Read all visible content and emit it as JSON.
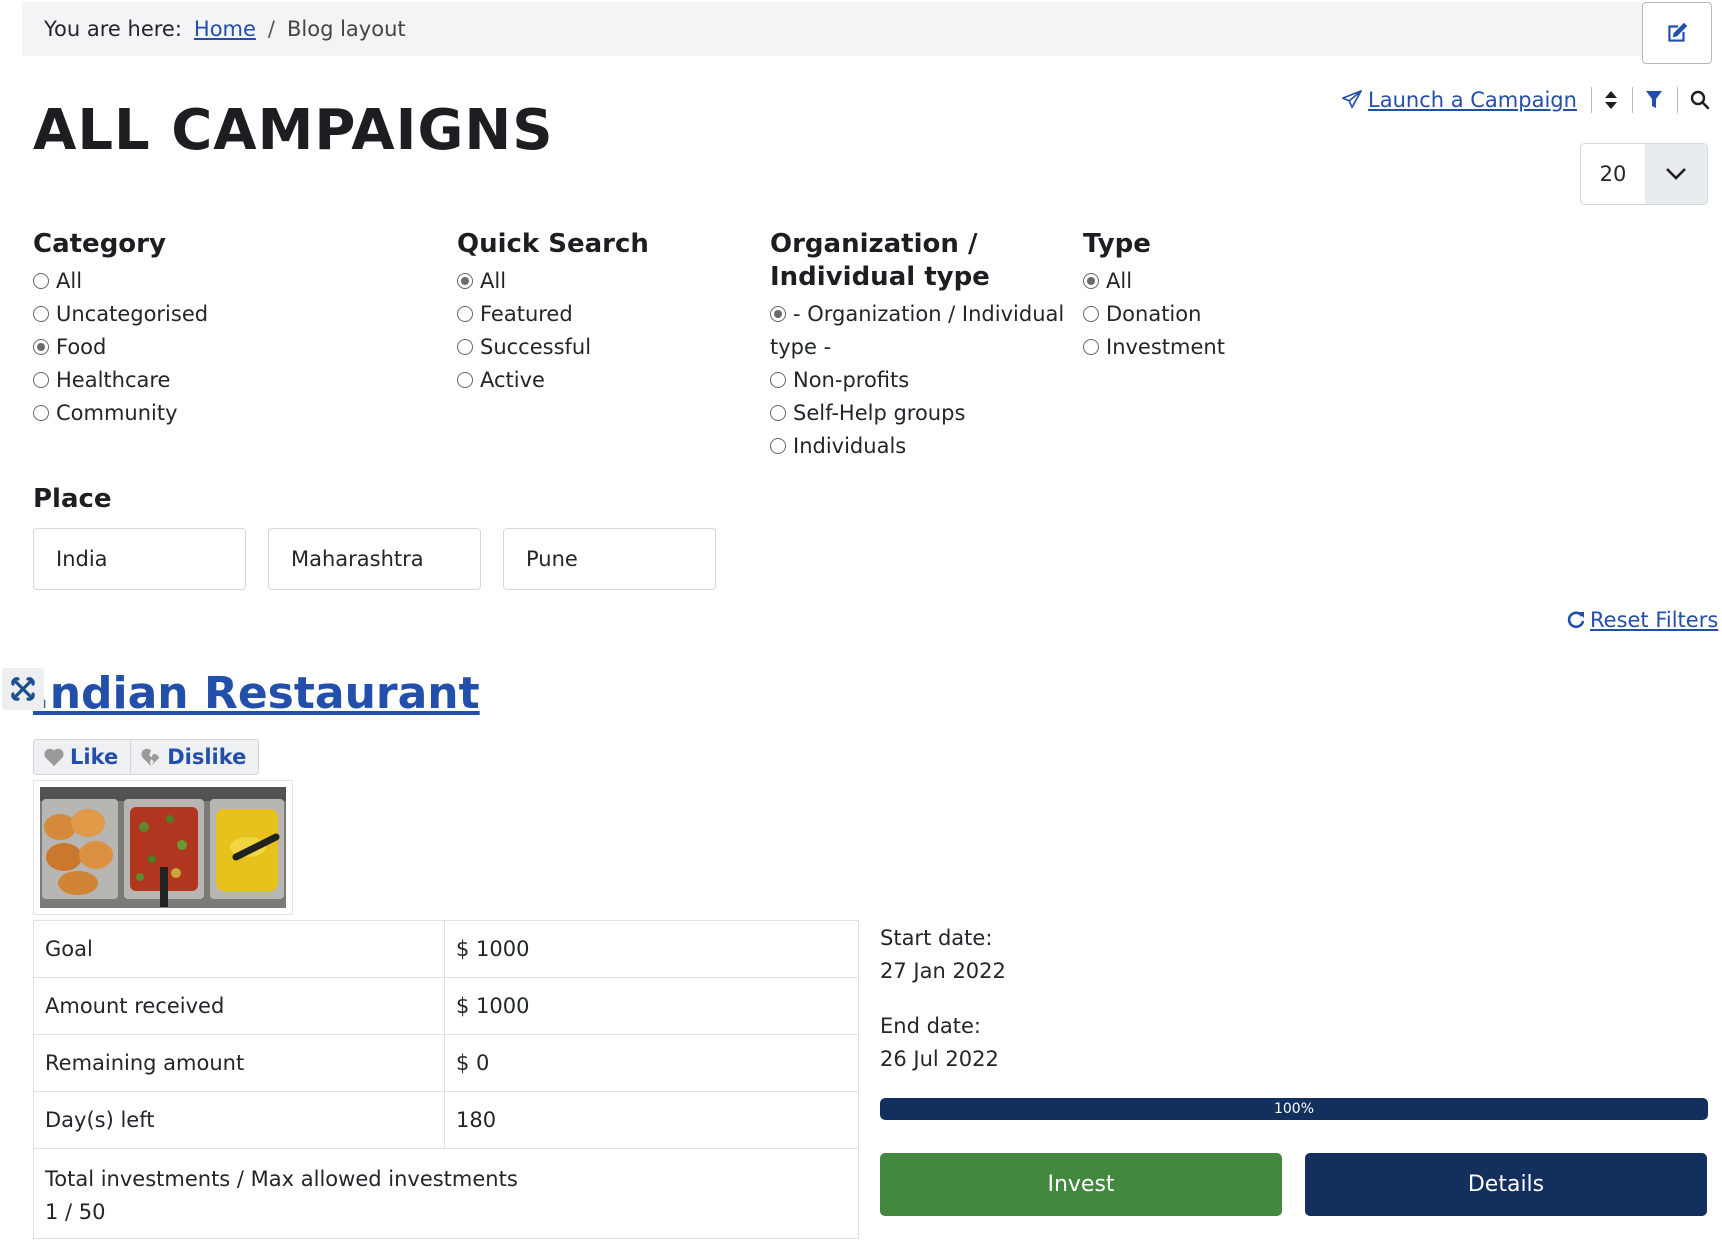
{
  "breadcrumb": {
    "prefix": "You are here:",
    "home": "Home",
    "separator": "/",
    "current": "Blog layout"
  },
  "page_title": "ALL CAMPAIGNS",
  "toolbar": {
    "launch_label": "Launch a Campaign",
    "icons": [
      "paper-plane-icon",
      "sort-icon",
      "filter-icon",
      "search-icon"
    ]
  },
  "limit_select": {
    "value": "20"
  },
  "filters": {
    "category": {
      "title": "Category",
      "options": [
        {
          "label": "All",
          "checked": false
        },
        {
          "label": "Uncategorised",
          "checked": false
        },
        {
          "label": "Food",
          "checked": true
        },
        {
          "label": "Healthcare",
          "checked": false
        },
        {
          "label": "Community",
          "checked": false
        }
      ]
    },
    "quick_search": {
      "title": "Quick Search",
      "options": [
        {
          "label": "All",
          "checked": true
        },
        {
          "label": "Featured",
          "checked": false
        },
        {
          "label": "Successful",
          "checked": false
        },
        {
          "label": "Active",
          "checked": false
        }
      ]
    },
    "org_type": {
      "title_line1": "Organization /",
      "title_line2": "Individual type",
      "options": [
        {
          "label_line1": "- Organization / Individual",
          "label_line2": "type -",
          "checked": true
        },
        {
          "label": "Non-profits",
          "checked": false
        },
        {
          "label": "Self-Help groups",
          "checked": false
        },
        {
          "label": "Individuals",
          "checked": false
        }
      ]
    },
    "type": {
      "title": "Type",
      "options": [
        {
          "label": "All",
          "checked": true
        },
        {
          "label": "Donation",
          "checked": false
        },
        {
          "label": "Investment",
          "checked": false
        }
      ]
    },
    "place": {
      "title": "Place",
      "country": "India",
      "state": "Maharashtra",
      "city": "Pune"
    }
  },
  "reset_label": "Reset Filters",
  "campaign": {
    "title": ".ndian Restaurant",
    "like_label": "Like",
    "dislike_label": "Dislike",
    "table": [
      {
        "label": "Goal",
        "value": "$ 1000"
      },
      {
        "label": "Amount received",
        "value": "$ 1000"
      },
      {
        "label": "Remaining amount",
        "value": "$ 0"
      },
      {
        "label": "Day(s) left",
        "value": "180"
      }
    ],
    "investments_label": "Total investments / Max allowed investments",
    "investments_value": "1 / 50",
    "start_label": "Start date:",
    "start_date": "27 Jan 2022",
    "end_label": "End date:",
    "end_date": "26 Jul 2022",
    "progress_label": "100%",
    "progress_fraction": 1.0,
    "invest_label": "Invest",
    "details_label": "Details"
  },
  "colors": {
    "link": "#224faa",
    "invest": "#43883f",
    "details": "#132f5e",
    "progress": "#132f5e"
  }
}
